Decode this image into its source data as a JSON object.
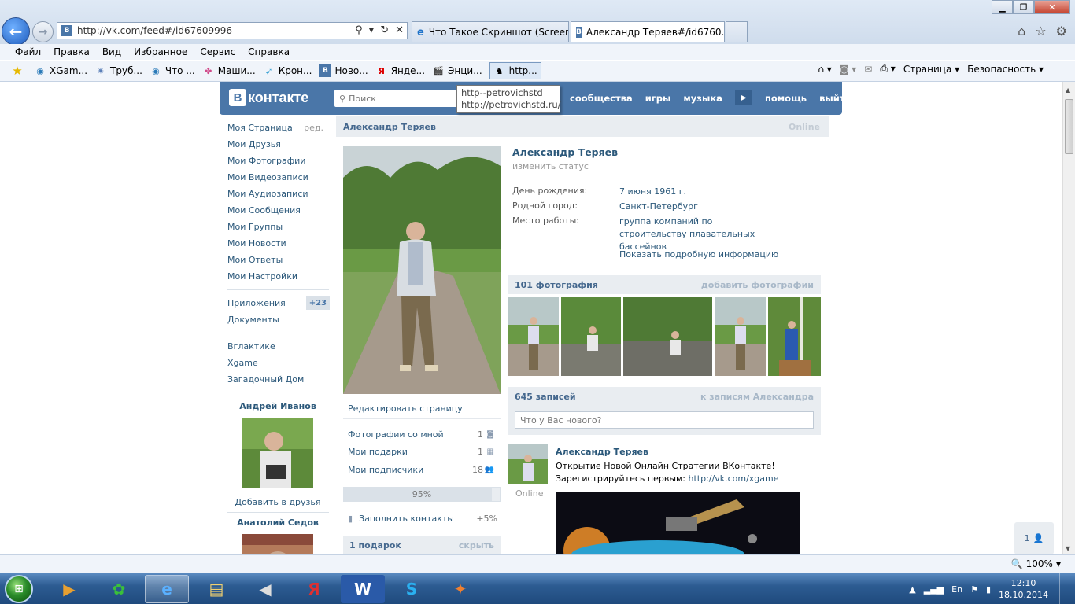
{
  "browser": {
    "address": "http://vk.com/feed#/id67609996",
    "tabs": [
      {
        "title": "Что Такое Скриншот (Screens..."
      },
      {
        "title": "Александр Теряев#/id6760..."
      }
    ],
    "menu": [
      "Файл",
      "Правка",
      "Вид",
      "Избранное",
      "Сервис",
      "Справка"
    ],
    "favorites": [
      {
        "label": "XGam...",
        "icon": "globe-icon"
      },
      {
        "label": "Труб...",
        "icon": "star-icon"
      },
      {
        "label": "Что ...",
        "icon": "globe-icon"
      },
      {
        "label": "Маши...",
        "icon": "puzzle-icon"
      },
      {
        "label": "Крон...",
        "icon": "tag-icon"
      },
      {
        "label": "Ново...",
        "icon": "vk-icon"
      },
      {
        "label": "Янде...",
        "icon": "yandex-icon"
      },
      {
        "label": "Энци...",
        "icon": "clapper-icon"
      },
      {
        "label": "http...",
        "icon": "person-icon"
      }
    ],
    "command_bar": {
      "page": "Страница",
      "safety": "Безопасность"
    },
    "zoom": "100%"
  },
  "vk": {
    "logo": "контакте",
    "logo_letter": "В",
    "search_placeholder": "Поиск",
    "nav": [
      "сообщества",
      "игры",
      "музыка",
      "помощь",
      "выйти"
    ],
    "tooltip": {
      "line1": "http--petrovichstd",
      "line2": "http://petrovichstd.ru/"
    },
    "left_menu": [
      {
        "label": "Моя Страница",
        "extra": "ред."
      },
      {
        "label": "Мои Друзья"
      },
      {
        "label": "Мои Фотографии"
      },
      {
        "label": "Мои Видеозаписи"
      },
      {
        "label": "Мои Аудиозаписи"
      },
      {
        "label": "Мои Сообщения"
      },
      {
        "label": "Мои Группы"
      },
      {
        "label": "Мои Новости"
      },
      {
        "label": "Мои Ответы"
      },
      {
        "label": "Мои Настройки"
      }
    ],
    "apps": {
      "label": "Приложения",
      "badge": "+23"
    },
    "docs": "Документы",
    "games": [
      "Вглактике",
      "Xgame",
      "Загадочный Дом"
    ],
    "friends": [
      {
        "name": "Андрей Иванов",
        "action": "Добавить в друзья"
      },
      {
        "name": "Анатолий Седов"
      }
    ],
    "profile": {
      "header_name": "Александр Теряев",
      "online": "Online",
      "name": "Александр Теряев",
      "status": "изменить статус",
      "info": [
        {
          "key": "День рождения:",
          "value": "7 июня 1961 г."
        },
        {
          "key": "Родной город:",
          "value": "Санкт-Петербург"
        },
        {
          "key": "Место работы:",
          "value": "группа компаний по строительству плавательных бассейнов"
        }
      ],
      "show_more": "Показать подробную информацию",
      "edit_page": "Редактировать страницу",
      "links": [
        {
          "label": "Фотографии со мной",
          "count": "1",
          "icon": "camera-icon"
        },
        {
          "label": "Мои подарки",
          "count": "1",
          "icon": "gift-icon"
        },
        {
          "label": "Мои подписчики",
          "count": "18",
          "icon": "people-icon"
        }
      ],
      "progress": {
        "text": "95%",
        "value": 95
      },
      "fill_contacts": {
        "label": "Заполнить контакты",
        "pct": "+5%"
      },
      "gifts": {
        "title": "1 подарок",
        "hide": "скрыть"
      },
      "photos": {
        "title": "101 фотография",
        "action": "добавить фотографии"
      },
      "wall": {
        "title": "645 записей",
        "action": "к записям Александра",
        "placeholder": "Что у Вас нового?"
      },
      "post": {
        "author": "Александр Теряев",
        "online": "Online",
        "line1": "Открытие Новой Онлайн Стратегии ВКонтакте!",
        "line2": "Зарегистрируйтесь первым: ",
        "link": "http://vk.com/xgame"
      }
    },
    "chat_count": "1"
  },
  "taskbar": {
    "lang": "En",
    "time": "12:10",
    "date": "18.10.2014"
  },
  "colors": {
    "vk_blue": "#4a76a8",
    "link": "#2b587a"
  }
}
